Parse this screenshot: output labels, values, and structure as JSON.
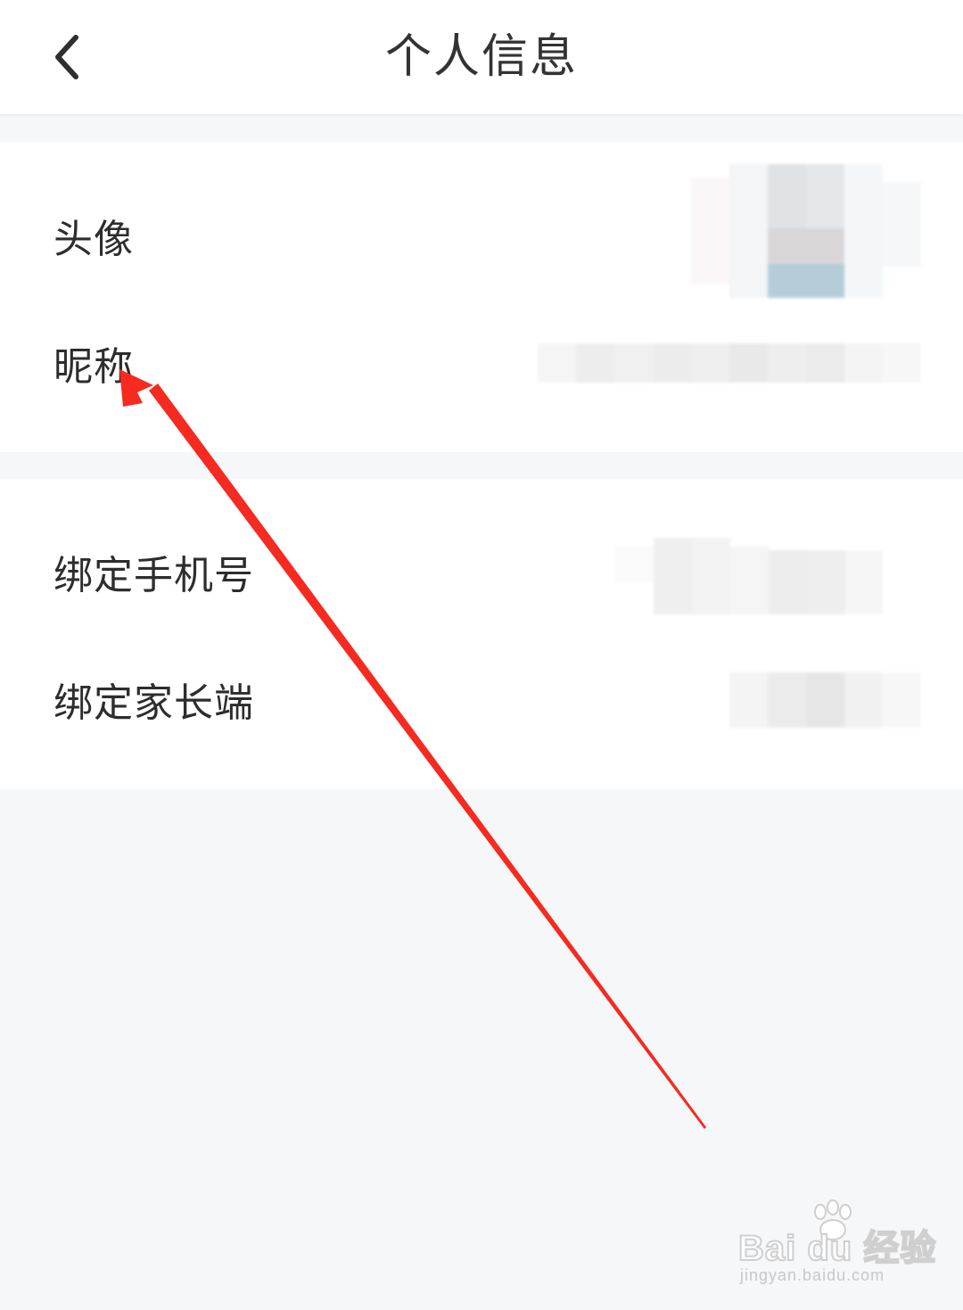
{
  "header": {
    "title": "个人信息",
    "back_icon": "chevron-left-icon"
  },
  "groups": [
    {
      "rows": [
        {
          "label": "头像",
          "value_type": "avatar-image-blurred"
        },
        {
          "label": "昵称",
          "value_type": "text-blurred"
        }
      ]
    },
    {
      "rows": [
        {
          "label": "绑定手机号",
          "value_type": "text-blurred"
        },
        {
          "label": "绑定家长端",
          "value_type": "text-blurred"
        }
      ]
    }
  ],
  "annotation": {
    "type": "red-arrow",
    "color": "#f52a20",
    "points_to": "昵称"
  },
  "watermark": {
    "brand": "Bai du 经验",
    "url": "jingyan.baidu.com",
    "icon": "paw-icon"
  },
  "colors": {
    "background": "#f6f7f9",
    "surface": "#ffffff",
    "text": "#2d2d2d",
    "annotation": "#f52a20"
  }
}
